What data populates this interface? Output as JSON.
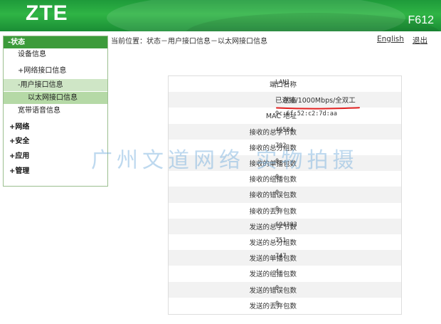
{
  "header": {
    "logo": "ZTE",
    "model": "F612"
  },
  "topbar": {
    "breadcrumb": "当前位置：状态－用户接口信息－以太网接口信息",
    "language_link": "English",
    "logout_link": "退出"
  },
  "sidebar": {
    "status": "-状态",
    "device_info": "设备信息",
    "network_if_info": "+网络接口信息",
    "user_if_info": "-用户接口信息",
    "ethernet_if_info": "以太网接口信息",
    "broadband_voice": "宽带语音信息",
    "network": "+网络",
    "security": "+安全",
    "application": "+应用",
    "management": "+管理"
  },
  "table": [
    {
      "label": "端口名称",
      "value": "LAN1"
    },
    {
      "label": "状态",
      "value": "已连接/1000Mbps/全双工"
    },
    {
      "label": "MAC 地址",
      "value": "9c:6f:52:c2:7d:aa"
    },
    {
      "label": "接收的总字节数",
      "value": "46584"
    },
    {
      "label": "接收的总分组数",
      "value": "702"
    },
    {
      "label": "接收的单播包数",
      "value": "0"
    },
    {
      "label": "接收的组播包数",
      "value": "0"
    },
    {
      "label": "接收的错误包数",
      "value": "0"
    },
    {
      "label": "接收的丢弃包数",
      "value": "0"
    },
    {
      "label": "发送的总字节数",
      "value": "694383"
    },
    {
      "label": "发送的总分组数",
      "value": "751"
    },
    {
      "label": "发送的单播包数",
      "value": "747"
    },
    {
      "label": "发送的组播包数",
      "value": "4"
    },
    {
      "label": "发送的错误包数",
      "value": "0"
    },
    {
      "label": "发送的丢弃包数",
      "value": "0"
    }
  ],
  "watermark": "广州文道网络 实物拍摄",
  "colors": {
    "header_green": "#2fb445",
    "nav_active": "#3c9b3a",
    "annotation_red": "#e02020"
  }
}
